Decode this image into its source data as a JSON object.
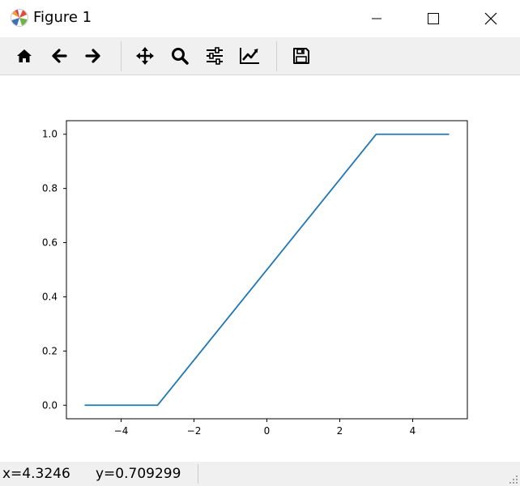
{
  "window": {
    "title": "Figure 1",
    "icon": "matplotlib-icon",
    "controls": [
      "minimize-icon",
      "maximize-icon",
      "close-icon"
    ]
  },
  "toolbar": {
    "buttons": [
      {
        "name": "home-button",
        "icon": "home-icon"
      },
      {
        "name": "back-button",
        "icon": "arrow-left-icon"
      },
      {
        "name": "forward-button",
        "icon": "arrow-right-icon"
      },
      {
        "name": "pan-button",
        "icon": "move-icon"
      },
      {
        "name": "zoom-button",
        "icon": "magnifier-icon"
      },
      {
        "name": "subplots-button",
        "icon": "sliders-icon"
      },
      {
        "name": "edit-axis-button",
        "icon": "line-chart-icon"
      },
      {
        "name": "save-button",
        "icon": "floppy-disk-icon"
      }
    ]
  },
  "chart_data": {
    "type": "line",
    "x": [
      -5,
      -3,
      3,
      5
    ],
    "series": [
      {
        "values": [
          0.0,
          0.0,
          1.0,
          1.0
        ],
        "color": "#1f77b4"
      }
    ],
    "xlim": [
      -5.5,
      5.5
    ],
    "ylim": [
      -0.05,
      1.05
    ],
    "xticks": [
      -4,
      -2,
      0,
      2,
      4
    ],
    "xtick_labels": [
      "−4",
      "−2",
      "0",
      "2",
      "4"
    ],
    "yticks": [
      0.0,
      0.2,
      0.4,
      0.6,
      0.8,
      1.0
    ],
    "ytick_labels": [
      "0.0",
      "0.2",
      "0.4",
      "0.6",
      "0.8",
      "1.0"
    ],
    "grid": false
  },
  "status": {
    "x": "x=4.3246",
    "y": "y=0.709299"
  }
}
